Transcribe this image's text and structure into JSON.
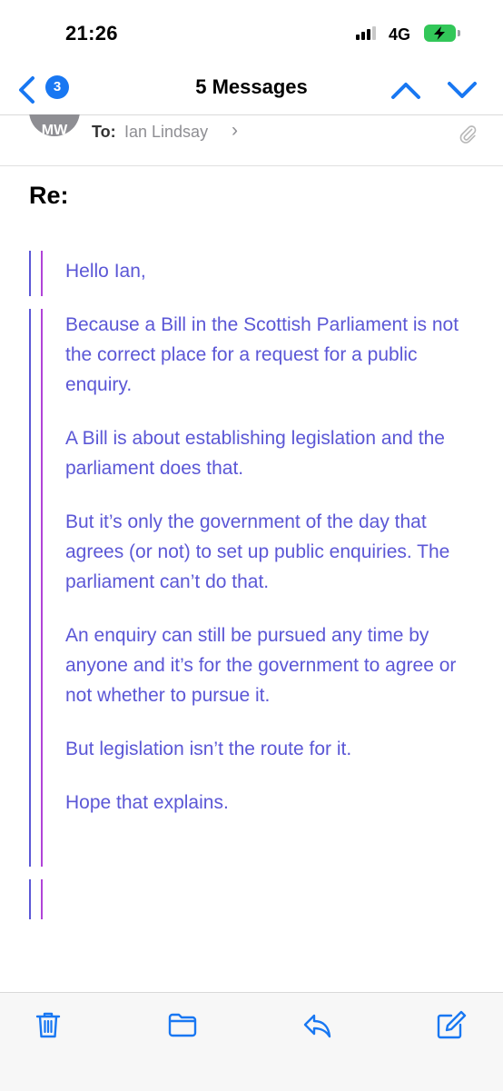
{
  "status_bar": {
    "time": "21:26",
    "network": "4G"
  },
  "nav": {
    "back_count": "3",
    "title": "5 Messages"
  },
  "header": {
    "avatar_initials": "MW",
    "to_label": "To:",
    "recipient": "Ian Lindsay",
    "chevron": "›"
  },
  "subject": "Re:",
  "body": {
    "greeting": "Hello Ian,",
    "paragraphs": [
      "Because a Bill in the Scottish Parliament is not the correct place for a request for a public enquiry.",
      "A Bill is about establishing legislation and the parliament does that.",
      "But it’s only the government of the day that agrees (or not) to set up public enquiries. The parliament can’t do that.",
      "An enquiry can still be pursued any time by anyone and it’s for the government to agree or not whether to pursue it.",
      "But legislation isn’t the route for it."
    ],
    "closing": "Hope that explains."
  },
  "colors": {
    "accent": "#1877f2",
    "quoted_text": "#5b57d6",
    "quote_bar_blue": "#5b57d6",
    "quote_bar_purple": "#b044d8",
    "battery_green": "#32c759"
  },
  "icons": {
    "back": "chevron-left-icon",
    "up": "chevron-up-icon",
    "down": "chevron-down-icon",
    "attachment": "paperclip-icon",
    "trash": "trash-icon",
    "folder": "folder-icon",
    "reply": "reply-icon",
    "compose": "compose-icon"
  }
}
